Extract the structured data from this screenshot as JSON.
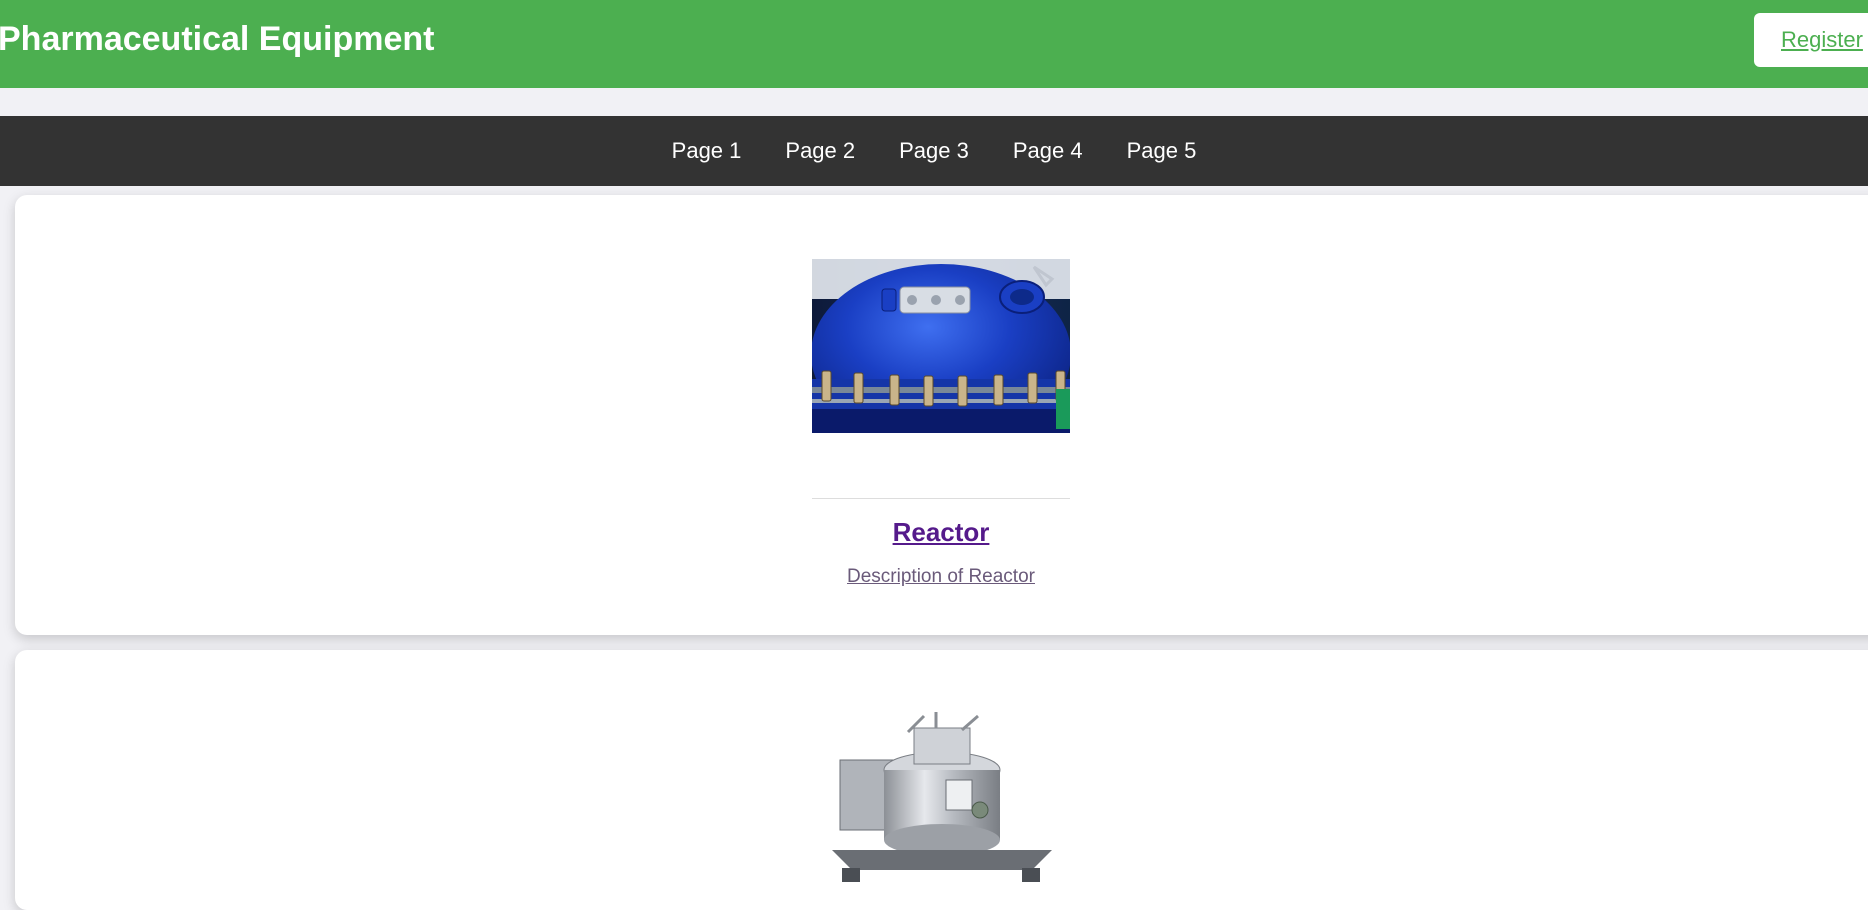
{
  "header": {
    "title": "Pharmaceutical Equipment",
    "register_label": "Register"
  },
  "nav": {
    "items": [
      "Page 1",
      "Page 2",
      "Page 3",
      "Page 4",
      "Page 5"
    ]
  },
  "products": [
    {
      "name": "Reactor",
      "description": "Description of Reactor",
      "image": "reactor-image"
    },
    {
      "image": "centrifuge-image"
    }
  ],
  "colors": {
    "header_bg": "#4caf50",
    "nav_bg": "#333333",
    "link_visited": "#551a8b"
  }
}
